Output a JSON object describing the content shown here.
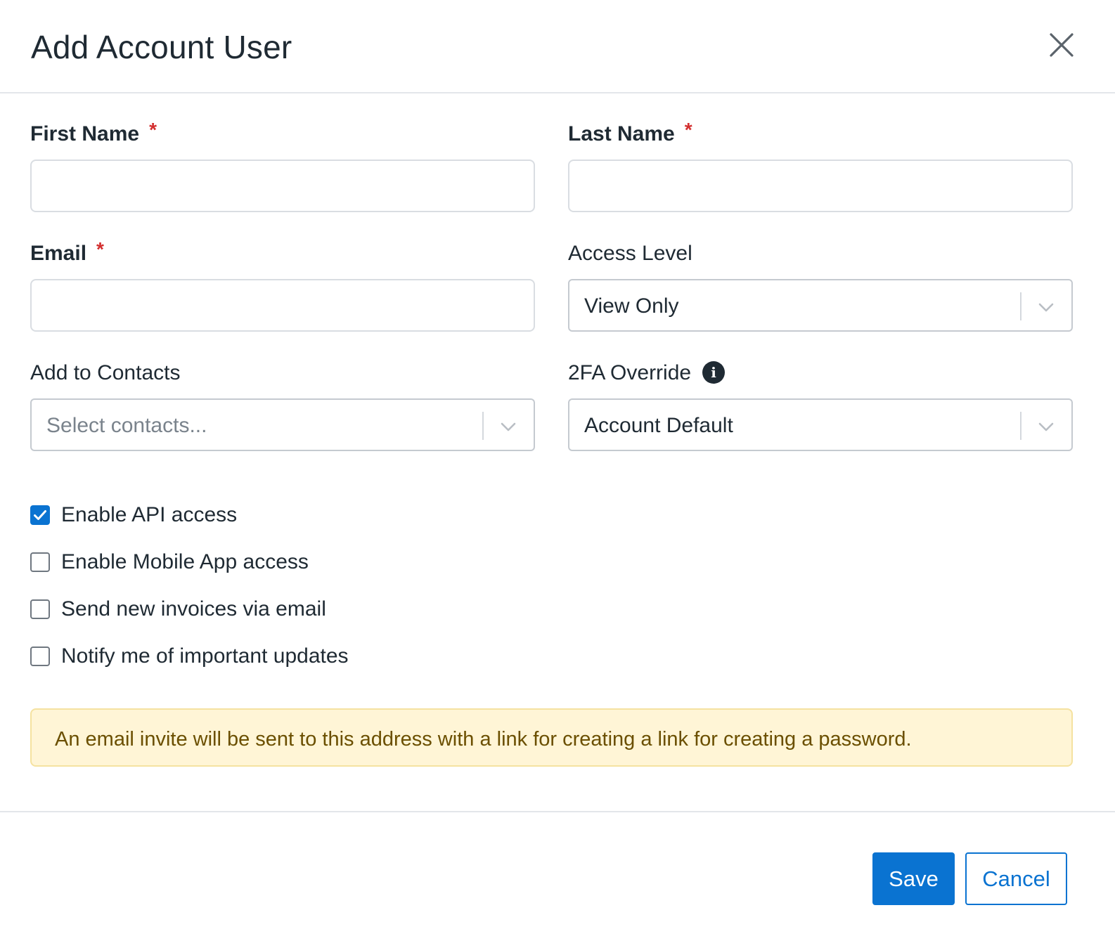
{
  "modal": {
    "title": "Add Account User",
    "close_icon": "close-icon"
  },
  "form": {
    "first_name": {
      "label": "First Name",
      "required_mark": "*",
      "value": "",
      "placeholder": ""
    },
    "last_name": {
      "label": "Last Name",
      "required_mark": "*",
      "value": "",
      "placeholder": ""
    },
    "email": {
      "label": "Email",
      "required_mark": "*",
      "value": "",
      "placeholder": ""
    },
    "access_level": {
      "label": "Access Level",
      "selected": "View Only",
      "icon": "chevron-down-icon"
    },
    "add_to_contacts": {
      "label": "Add to Contacts",
      "placeholder": "Select contacts...",
      "icon": "chevron-down-icon"
    },
    "twofa_override": {
      "label": "2FA Override",
      "selected": "Account Default",
      "info_icon": "info-icon",
      "info_glyph": "i"
    }
  },
  "checkboxes": [
    {
      "label": "Enable API access",
      "checked": true
    },
    {
      "label": "Enable Mobile App access",
      "checked": false
    },
    {
      "label": "Send new invoices via email",
      "checked": false
    },
    {
      "label": "Notify me of important updates",
      "checked": false
    }
  ],
  "notice": {
    "text": "An email invite will be sent to this address with a link for creating a link for creating a password."
  },
  "footer": {
    "save_label": "Save",
    "cancel_label": "Cancel"
  },
  "colors": {
    "primary": "#0a73d1",
    "required": "#d32f2f",
    "notice_bg": "#fff5d6",
    "notice_text": "#6b4f00"
  }
}
